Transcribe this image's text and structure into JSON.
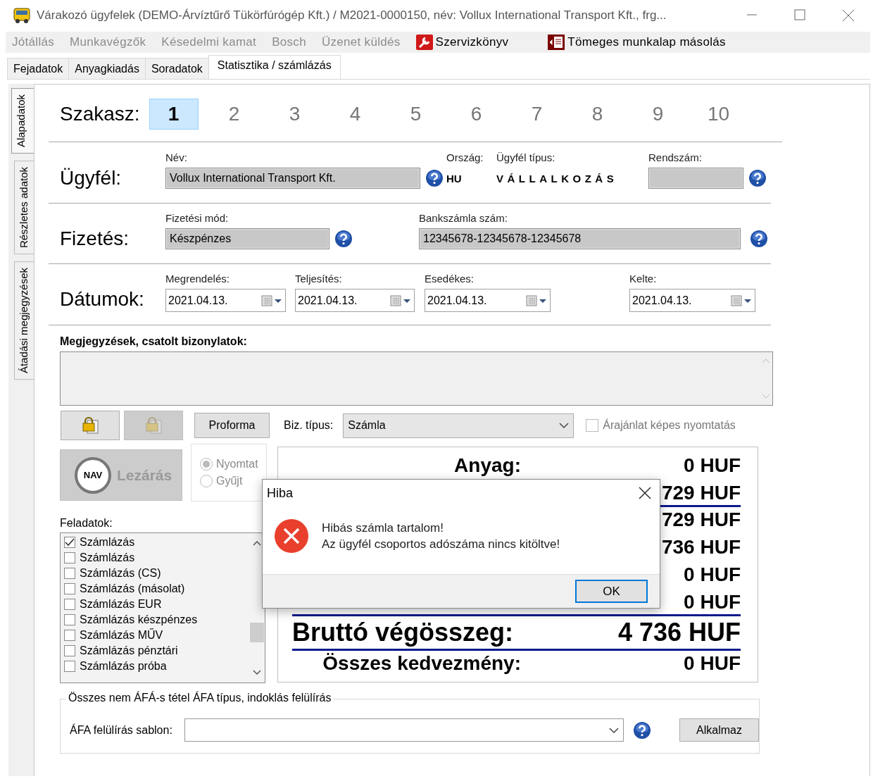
{
  "window": {
    "title": "Várakozó ügyfelek (DEMO-Árvíztűrő Tükörfúrógép Kft.) / M2021-0000150, név: Vollux International Transport Kft., frg..."
  },
  "menu": [
    {
      "label": "Jótállás",
      "disabled": true,
      "kind": "plain"
    },
    {
      "label": "Munkavégzők",
      "disabled": true,
      "kind": "plain"
    },
    {
      "label": "Késedelmi kamat",
      "disabled": true,
      "kind": "plain"
    },
    {
      "label": "Bosch",
      "disabled": true,
      "kind": "plain"
    },
    {
      "label": "Üzenet küldés",
      "disabled": true,
      "kind": "plain"
    },
    {
      "label": "Szervizkönyv",
      "disabled": false,
      "kind": "wrench"
    },
    {
      "label": "Tömeges munkalap másolás",
      "disabled": false,
      "kind": "copy"
    }
  ],
  "tabs": [
    {
      "label": "Fejadatok",
      "selected": false
    },
    {
      "label": "Anyagkiadás",
      "selected": false
    },
    {
      "label": "Soradatok",
      "selected": false
    },
    {
      "label": "Statisztika / számlázás",
      "selected": true
    }
  ],
  "side_tabs": [
    {
      "label": "Alapadatok",
      "selected": true
    },
    {
      "label": "Részletes adatok",
      "selected": false
    },
    {
      "label": "Átadási megjegyzések",
      "selected": false
    }
  ],
  "stage": {
    "label": "Szakasz:",
    "steps": [
      {
        "label": "1",
        "selected": true
      },
      {
        "label": "2",
        "selected": false
      },
      {
        "label": "3",
        "selected": false
      },
      {
        "label": "4",
        "selected": false
      },
      {
        "label": "5",
        "selected": false
      },
      {
        "label": "6",
        "selected": false
      },
      {
        "label": "7",
        "selected": false
      },
      {
        "label": "8",
        "selected": false
      },
      {
        "label": "9",
        "selected": false
      },
      {
        "label": "10",
        "selected": false
      }
    ]
  },
  "customer": {
    "label": "Ügyfél:",
    "name_label": "Név:",
    "name": "Vollux International Transport Kft.",
    "country_label": "Ország:",
    "country": "HU",
    "type_label": "Ügyfél típus:",
    "type": "VÁLLALKOZÁS",
    "plate_label": "Rendszám:"
  },
  "payment": {
    "label": "Fizetés:",
    "method_label": "Fizetési mód:",
    "method": "Készpénzes",
    "bank_label": "Bankszámla szám:",
    "bank": "12345678-12345678-12345678"
  },
  "dates": {
    "label": "Dátumok:",
    "fields": [
      {
        "label": "Megrendelés:",
        "value": "2021.04.13."
      },
      {
        "label": "Teljesítés:",
        "value": "2021.04.13."
      },
      {
        "label": "Esedékes:",
        "value": "2021.04.13."
      },
      {
        "label": "Kelte:",
        "value": "2021.04.13."
      }
    ]
  },
  "notes": {
    "label": "Megjegyzések, csatolt bizonylatok:"
  },
  "toolbar": {
    "lock_buttons": [
      {
        "disabled": false
      },
      {
        "disabled": true
      }
    ],
    "proforma": "Proforma",
    "doc_type_label": "Biz. típus:",
    "doc_type": "Számla",
    "quote_print": {
      "label": "Árajánlat képes nyomtatás",
      "checked": false
    }
  },
  "close": {
    "badge": "NAV",
    "label": "Lezárás",
    "disabled": true,
    "modes": [
      {
        "label": "Nyomtat",
        "selected": true
      },
      {
        "label": "Gyűjt",
        "selected": false
      }
    ]
  },
  "tasks": {
    "label": "Feladatok:",
    "items": [
      {
        "label": "Számlázás",
        "checked": true
      },
      {
        "label": "Számlázás",
        "checked": false
      },
      {
        "label": "Számlázás (CS)",
        "checked": false
      },
      {
        "label": "Számlázás (másolat)",
        "checked": false
      },
      {
        "label": "Számlázás EUR",
        "checked": false
      },
      {
        "label": "Számlázás készpénzes",
        "checked": false
      },
      {
        "label": "Számlázás MŰV",
        "checked": false
      },
      {
        "label": "Számlázás pénztári",
        "checked": false
      },
      {
        "label": "Számlázás próba",
        "checked": false
      }
    ]
  },
  "summary": {
    "rows": [
      {
        "label": "Anyag:",
        "value": "0 HUF",
        "kind": "normal",
        "rule": false
      },
      {
        "value": "729 HUF",
        "kind": "normal",
        "rule": true
      },
      {
        "value": "729 HUF",
        "kind": "normal",
        "rule": false
      },
      {
        "value": "736 HUF",
        "kind": "normal",
        "rule": false
      },
      {
        "value": "0 HUF",
        "kind": "normal",
        "rule": false
      },
      {
        "value": "0 HUF",
        "kind": "normal",
        "rule": true
      },
      {
        "label": "Bruttó végösszeg:",
        "value": "4 736 HUF",
        "kind": "total",
        "rule": true
      },
      {
        "label": "Összes kedvezmény:",
        "value": "0 HUF",
        "kind": "normal",
        "rule": false
      }
    ]
  },
  "vat": {
    "legend": "Összes nem ÁFÁ-s tétel ÁFA típus, indoklás felülírás",
    "label": "ÁFA felülírás sablon:",
    "button": "Alkalmaz"
  },
  "dialog": {
    "title": "Hiba",
    "lines": [
      "Hibás számla tartalom!",
      "Az ügyfél csoportos adószáma nincs kitöltve!"
    ],
    "button": "OK"
  }
}
